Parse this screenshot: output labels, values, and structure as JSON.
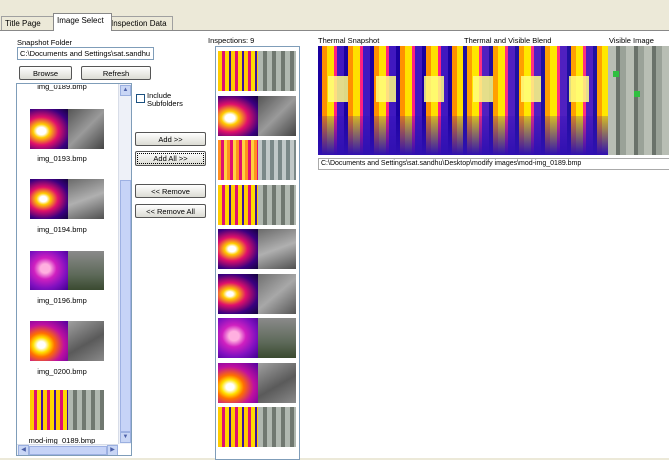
{
  "tabs": [
    {
      "label": "Title Page"
    },
    {
      "label": "Image Select"
    },
    {
      "label": "Inspection Data"
    }
  ],
  "left": {
    "folder_label": "Snapshot Folder",
    "folder_value": "C:\\Documents and Settings\\sat.sandhu",
    "browse_label": "Browse",
    "refresh_label": "Refresh",
    "include_label_1": "Include",
    "include_label_2": "Subfolders",
    "top_partial": "img_0189.bmp",
    "images": [
      {
        "name": "img_0193.bmp"
      },
      {
        "name": "img_0194.bmp"
      },
      {
        "name": "img_0196.bmp"
      },
      {
        "name": "img_0200.bmp"
      },
      {
        "name": "mod-img_0189.bmp"
      }
    ]
  },
  "buttons": {
    "add": "Add >>",
    "add_all": "Add All >>",
    "remove": "<< Remove",
    "remove_all": "<< Remove All"
  },
  "inspections": {
    "label": "Inspections: 9"
  },
  "preview": {
    "thermal_label": "Thermal Snapshot",
    "blend_label": "Thermal and Visible Blend",
    "visible_label": "Visible Image",
    "path": "C:\\Documents and Settings\\sat.sandhu\\Desktop\\modify images\\mod-img_0189.bmp"
  },
  "colors": {
    "panel": "#ece9d8",
    "accent": "#7f9db9",
    "scrollbar": "#c6d3f7"
  }
}
